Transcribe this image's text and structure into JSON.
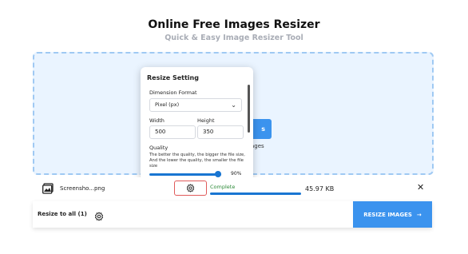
{
  "header": {
    "title": "Online Free Images Resizer",
    "subtitle": "Quick & Easy Image Resizer Tool"
  },
  "dropzone": {
    "button_label": "s",
    "caption": "ages"
  },
  "settings_popup": {
    "title": "Resize Setting",
    "dimension_format_label": "Dimension Format",
    "dimension_format_value": "Pixel (px)",
    "width_label": "Width",
    "width_value": "500",
    "height_label": "Height",
    "height_value": "350",
    "quality_label": "Quality",
    "quality_description": "The better the quality, the bigger the file size, And the lower the quality, the smaller the file size",
    "quality_value_text": "90%",
    "quality_value": 90
  },
  "file_item": {
    "name": "Screensho...png",
    "status": "Complete",
    "progress": 1.0,
    "size": "45.97 KB"
  },
  "bottom_bar": {
    "resize_all_label": "Resize to all",
    "resize_all_count": "(1)",
    "resize_button_label": "RESIZE IMAGES"
  },
  "colors": {
    "accent": "#3b93ee",
    "dropzone_bg": "#eaf4ff",
    "status_green": "#2e8b3a",
    "highlight_red": "#e05a5a"
  }
}
